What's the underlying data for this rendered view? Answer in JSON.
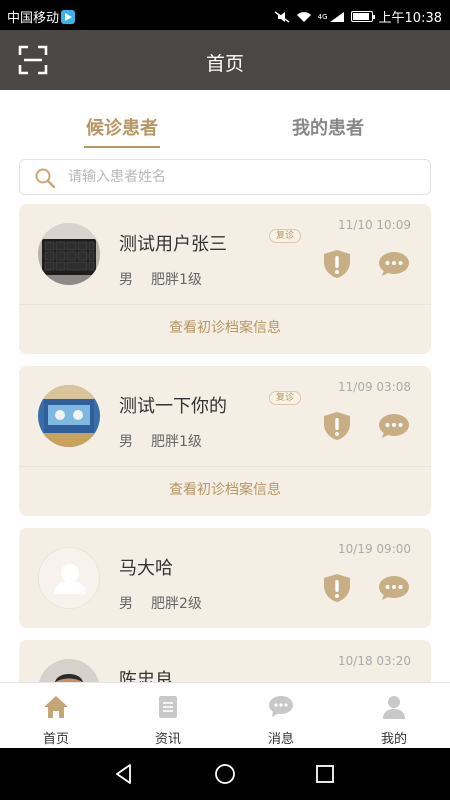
{
  "status_bar": {
    "carrier": "中国移动",
    "network": "4G",
    "time": "上午10:38"
  },
  "header": {
    "title": "首页",
    "left_icon": "scan-icon"
  },
  "tabs": [
    {
      "label": "候诊患者",
      "active": true
    },
    {
      "label": "我的患者",
      "active": false
    }
  ],
  "search": {
    "placeholder": "请输入患者姓名",
    "value": ""
  },
  "patients": [
    {
      "name": "测试用户张三",
      "badge": "复诊",
      "gender": "男",
      "condition": "肥胖1级",
      "time": "11/10 10:09",
      "link": "查看初诊档案信息",
      "avatar": "keyboard-photo"
    },
    {
      "name": "测试一下你的",
      "badge": "复诊",
      "gender": "男",
      "condition": "肥胖1级",
      "time": "11/09 03:08",
      "link": "查看初诊档案信息",
      "avatar": "poster-photo"
    },
    {
      "name": "马大哈",
      "badge": "",
      "gender": "男",
      "condition": "肥胖2级",
      "time": "10/19 09:00",
      "link": "",
      "avatar": "default-avatar"
    },
    {
      "name": "陈忠良",
      "badge": "",
      "gender": "",
      "condition": "",
      "time": "10/18 03:20",
      "link": "",
      "avatar": "person-photo"
    }
  ],
  "bottom_nav": [
    {
      "label": "首页",
      "icon": "home-icon",
      "active": true
    },
    {
      "label": "资讯",
      "icon": "news-icon",
      "active": false
    },
    {
      "label": "消息",
      "icon": "message-icon",
      "active": false
    },
    {
      "label": "我的",
      "icon": "profile-icon",
      "active": false
    }
  ],
  "colors": {
    "accent": "#b79663",
    "card_bg": "#f4eee4",
    "header_bg": "#4a4744"
  }
}
